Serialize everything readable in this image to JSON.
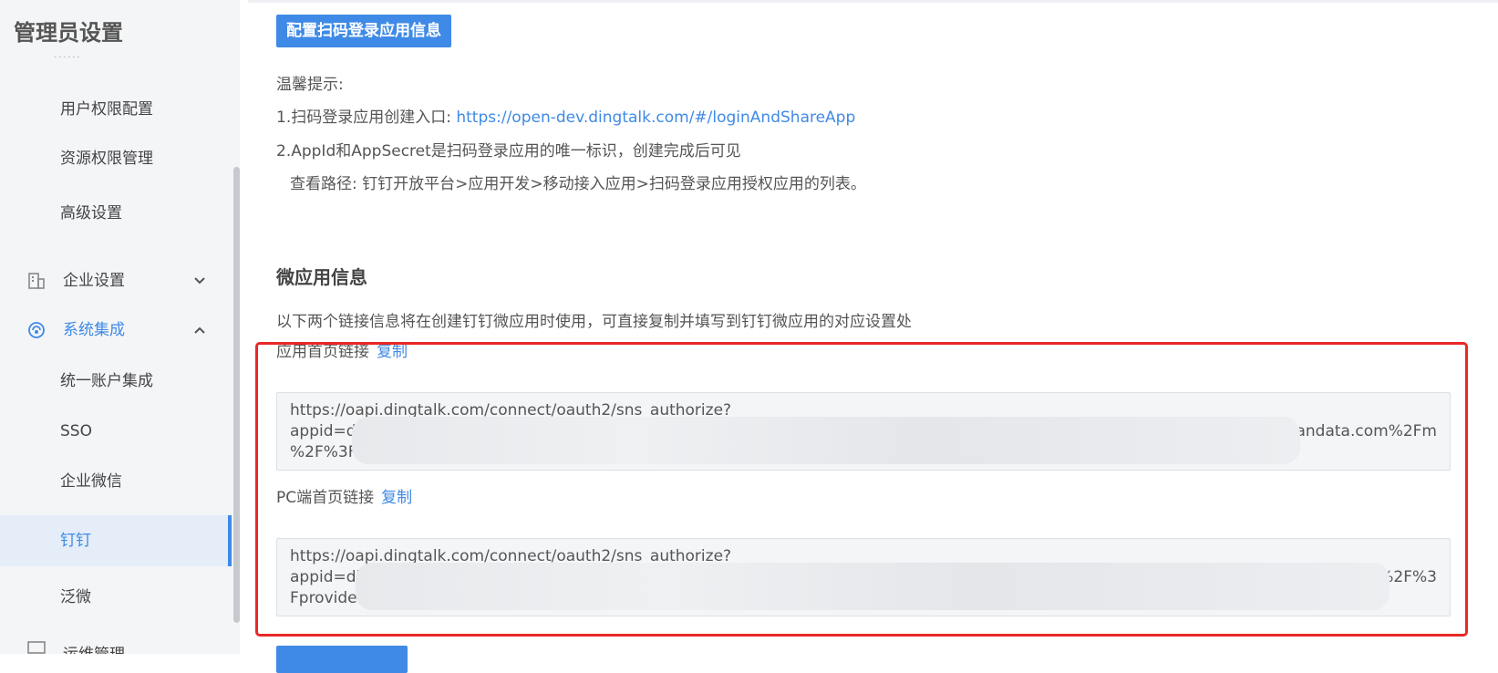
{
  "sidebar": {
    "title": "管理员设置",
    "items": [
      {
        "label": "用户权限配置"
      },
      {
        "label": "资源权限管理"
      },
      {
        "label": "高级设置"
      },
      {
        "label": "企业设置"
      },
      {
        "label": "系统集成"
      },
      {
        "label": "统一账户集成"
      },
      {
        "label": "SSO"
      },
      {
        "label": "企业微信"
      },
      {
        "label": "钉钉"
      },
      {
        "label": "泛微"
      },
      {
        "label": "运维管理"
      }
    ]
  },
  "main": {
    "config_button": "配置扫码登录应用信息",
    "tips": {
      "heading": "温馨提示:",
      "line1_prefix": "1.扫码登录应用创建入口:",
      "line1_link": "https://open-dev.dingtalk.com/#/loginAndShareApp",
      "line2": "2.AppId和AppSecret是扫码登录应用的唯一标识，创建完成后可见",
      "line3": "查看路径: 钉钉开放平台>应用开发>移动接入应用>扫码登录应用授权应用的列表。"
    },
    "micro_app": {
      "title": "微应用信息",
      "description": "以下两个链接信息将在创建钉钉微应用时使用，可直接复制并填写到钉钉微应用的对应设置处",
      "home_link_label": "应用首页链接",
      "home_link_copy": "复制",
      "home_link_value": {
        "line1": "https://oapi.dingtalk.com/connect/oauth2/sns_authorize?",
        "line2_start": "appid=di",
        "line2_end": "uandata.com%2Fm",
        "line3_start": "%2F%3Fp"
      },
      "pc_link_label": "PC端首页链接",
      "pc_link_copy": "复制",
      "pc_link_value": {
        "line1": "https://oapi.dingtalk.com/connect/oauth2/sns_authorize?",
        "line2_start": "appid=di",
        "line2_end": "n%2F%3",
        "line3_start": "Fprovide"
      }
    }
  },
  "colors": {
    "accent": "#3f8ae6",
    "highlight_border": "#ea2828",
    "sidebar_bg": "#f4f5f7"
  }
}
